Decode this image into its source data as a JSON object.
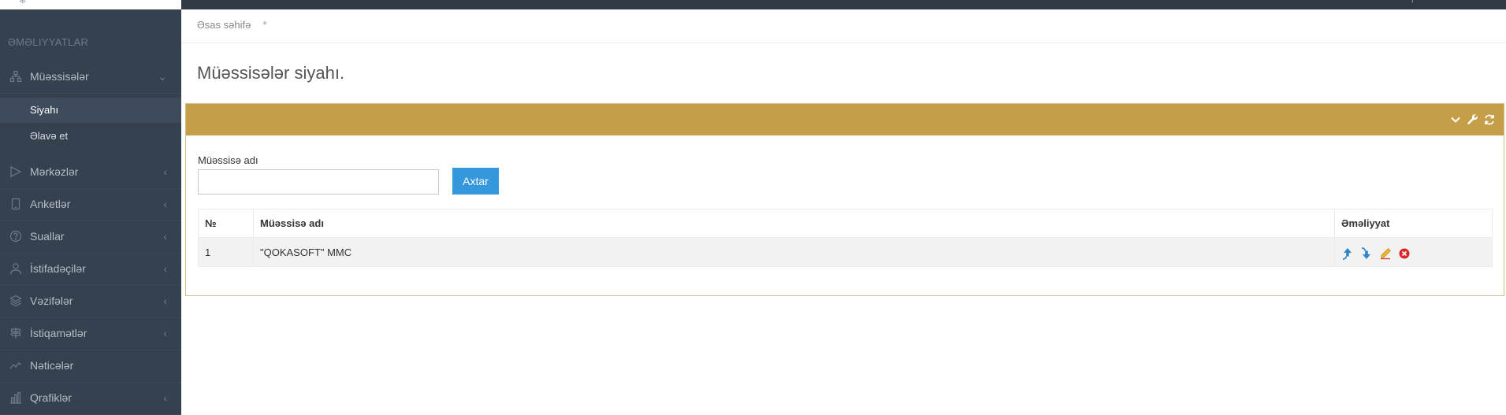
{
  "sidebar": {
    "heading": "ƏMƏLIYYATLAR",
    "items": [
      {
        "label": "Müəssisələr",
        "icon": "sitemap-icon",
        "expanded": true
      },
      {
        "label": "Mərkəzlər",
        "icon": "flag-icon"
      },
      {
        "label": "Anketlər",
        "icon": "tablet-icon"
      },
      {
        "label": "Suallar",
        "icon": "question-circle-icon"
      },
      {
        "label": "İstifadəçilər",
        "icon": "user-icon"
      },
      {
        "label": "Vəzifələr",
        "icon": "layers-icon"
      },
      {
        "label": "İstiqamətlər",
        "icon": "signpost-icon"
      },
      {
        "label": "Nəticələr",
        "icon": "line-chart-icon"
      },
      {
        "label": "Qrafiklər",
        "icon": "bar-chart-icon"
      }
    ],
    "subitems": [
      {
        "label": "Siyahı",
        "active": true
      },
      {
        "label": "Əlavə et",
        "active": false
      }
    ]
  },
  "breadcrumb": {
    "home": "Əsas səhifə"
  },
  "page": {
    "title": "Müəssisələr siyahı."
  },
  "portlet": {
    "header_color": "#c49f47"
  },
  "search": {
    "label": "Müəssisə adı",
    "value": "",
    "placeholder": "",
    "button": "Axtar"
  },
  "table": {
    "headers": [
      "№",
      "Müəssisə adı",
      "Əməliyyat"
    ],
    "rows": [
      {
        "no": "1",
        "name": "\"QOKASOFT\" MMC"
      }
    ],
    "row_actions": [
      "move-up-icon",
      "move-down-icon",
      "edit-icon",
      "delete-icon"
    ]
  },
  "colors": {
    "sidebar": "#364150",
    "topbar": "#2f3a44",
    "accent": "#3598dc",
    "portlet": "#c49f47"
  }
}
